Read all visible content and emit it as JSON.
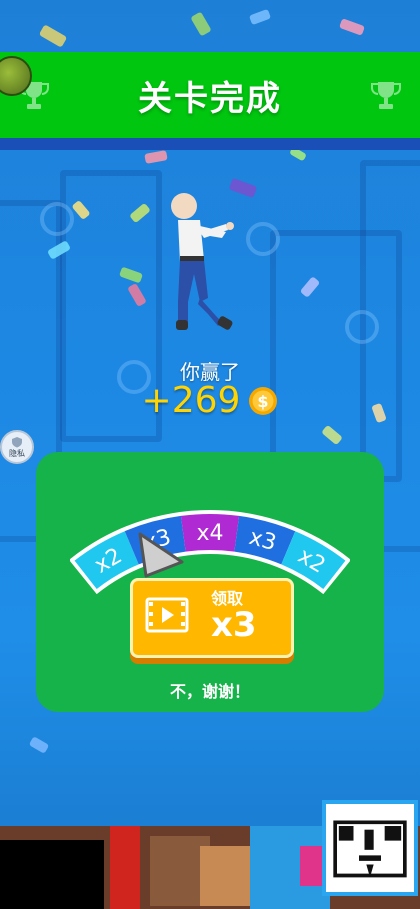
{
  "banner": {
    "title": "关卡完成"
  },
  "result": {
    "win_text": "你赢了",
    "reward_amount": "+269"
  },
  "privacy": {
    "label": "隐私"
  },
  "multiplier_wheel": {
    "segments": [
      {
        "label": "x2",
        "color": "#20c8ef"
      },
      {
        "label": "x3",
        "color": "#1f6fe0"
      },
      {
        "label": "x4",
        "color": "#b02ad3"
      },
      {
        "label": "x3",
        "color": "#1f6fe0"
      },
      {
        "label": "x2",
        "color": "#20c8ef"
      }
    ]
  },
  "claim_button": {
    "label": "领取",
    "multiplier": "x3"
  },
  "no_thanks": {
    "label": "不，谢谢！"
  },
  "colors": {
    "banner": "#00c60f",
    "panel": "#16b34a",
    "button": "#ffb700",
    "coin": "#f5a800"
  }
}
